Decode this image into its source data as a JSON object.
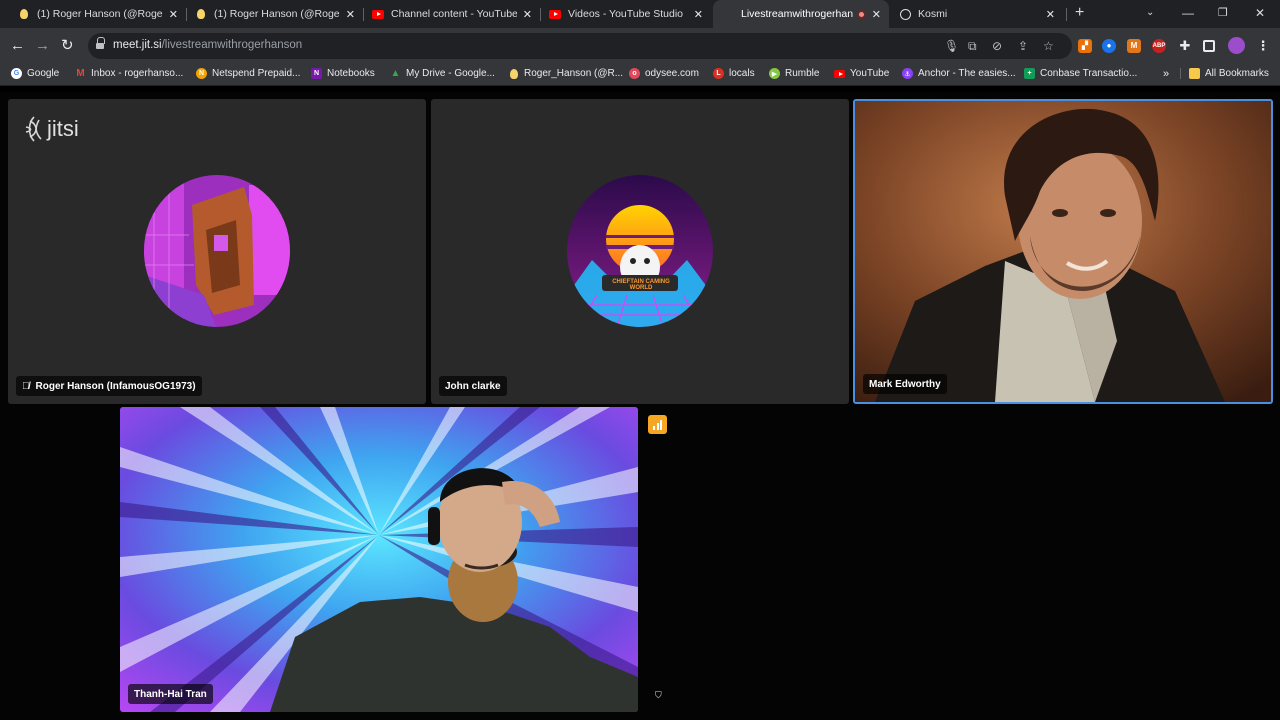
{
  "tabs": [
    {
      "title": "(1) Roger Hanson (@Roger_",
      "icon": "lightbulb-icon",
      "active": false
    },
    {
      "title": "(1) Roger Hanson (@Roger_",
      "icon": "lightbulb-icon",
      "active": false
    },
    {
      "title": "Channel content - YouTube",
      "icon": "youtube-icon",
      "active": false
    },
    {
      "title": "Videos - YouTube Studio",
      "icon": "youtube-icon",
      "active": false
    },
    {
      "title": "Livestreamwithrogerhan",
      "icon": "recording-icon",
      "active": true
    },
    {
      "title": "Kosmi",
      "icon": "globe-icon",
      "active": false
    }
  ],
  "toolbar": {
    "url_host": "meet.jit.si",
    "url_path": "/livestreamwithrogerhanson"
  },
  "bookmarks": [
    {
      "label": "Google",
      "icon": "google-icon",
      "color": "#4285f4"
    },
    {
      "label": "Inbox - rogerhanso...",
      "icon": "gmail-icon",
      "color": "#ea4335"
    },
    {
      "label": "Netspend Prepaid...",
      "icon": "netspend-icon",
      "color": "#f4a300"
    },
    {
      "label": "Notebooks",
      "icon": "onenote-icon",
      "color": "#7719aa"
    },
    {
      "label": "My Drive - Google...",
      "icon": "drive-icon",
      "color": "#34a853"
    },
    {
      "label": "Roger_Hanson (@R...",
      "icon": "lightbulb-icon",
      "color": "#f6d36b"
    },
    {
      "label": "odysee.com",
      "icon": "odysee-icon",
      "color": "#e2495c"
    },
    {
      "label": "locals",
      "icon": "locals-icon",
      "color": "#d93025"
    },
    {
      "label": "Rumble",
      "icon": "rumble-icon",
      "color": "#85c742"
    },
    {
      "label": "YouTube",
      "icon": "youtube-icon",
      "color": "#ff0000"
    },
    {
      "label": "Anchor - The easies...",
      "icon": "anchor-icon",
      "color": "#8940fa"
    },
    {
      "label": "Conbase Transactio...",
      "icon": "sheets-icon",
      "color": "#0f9d58"
    }
  ],
  "bookmarks_all": "All Bookmarks",
  "meeting": {
    "logo_text": "jitsi",
    "participants": [
      {
        "name": "Roger Hanson (InfamousOG1973)",
        "muted": true
      },
      {
        "name": "John clarke"
      },
      {
        "name": "Mark Edworthy",
        "active_speaker": true
      },
      {
        "name": "Thanh-Hai Tran"
      }
    ],
    "avatar_text": "CHIEFTAIN CAMING WORLD"
  },
  "colors": {
    "active_speaker_border": "#4a90e2",
    "tile_bg": "#292929",
    "stats_badge": "#f5a623"
  }
}
